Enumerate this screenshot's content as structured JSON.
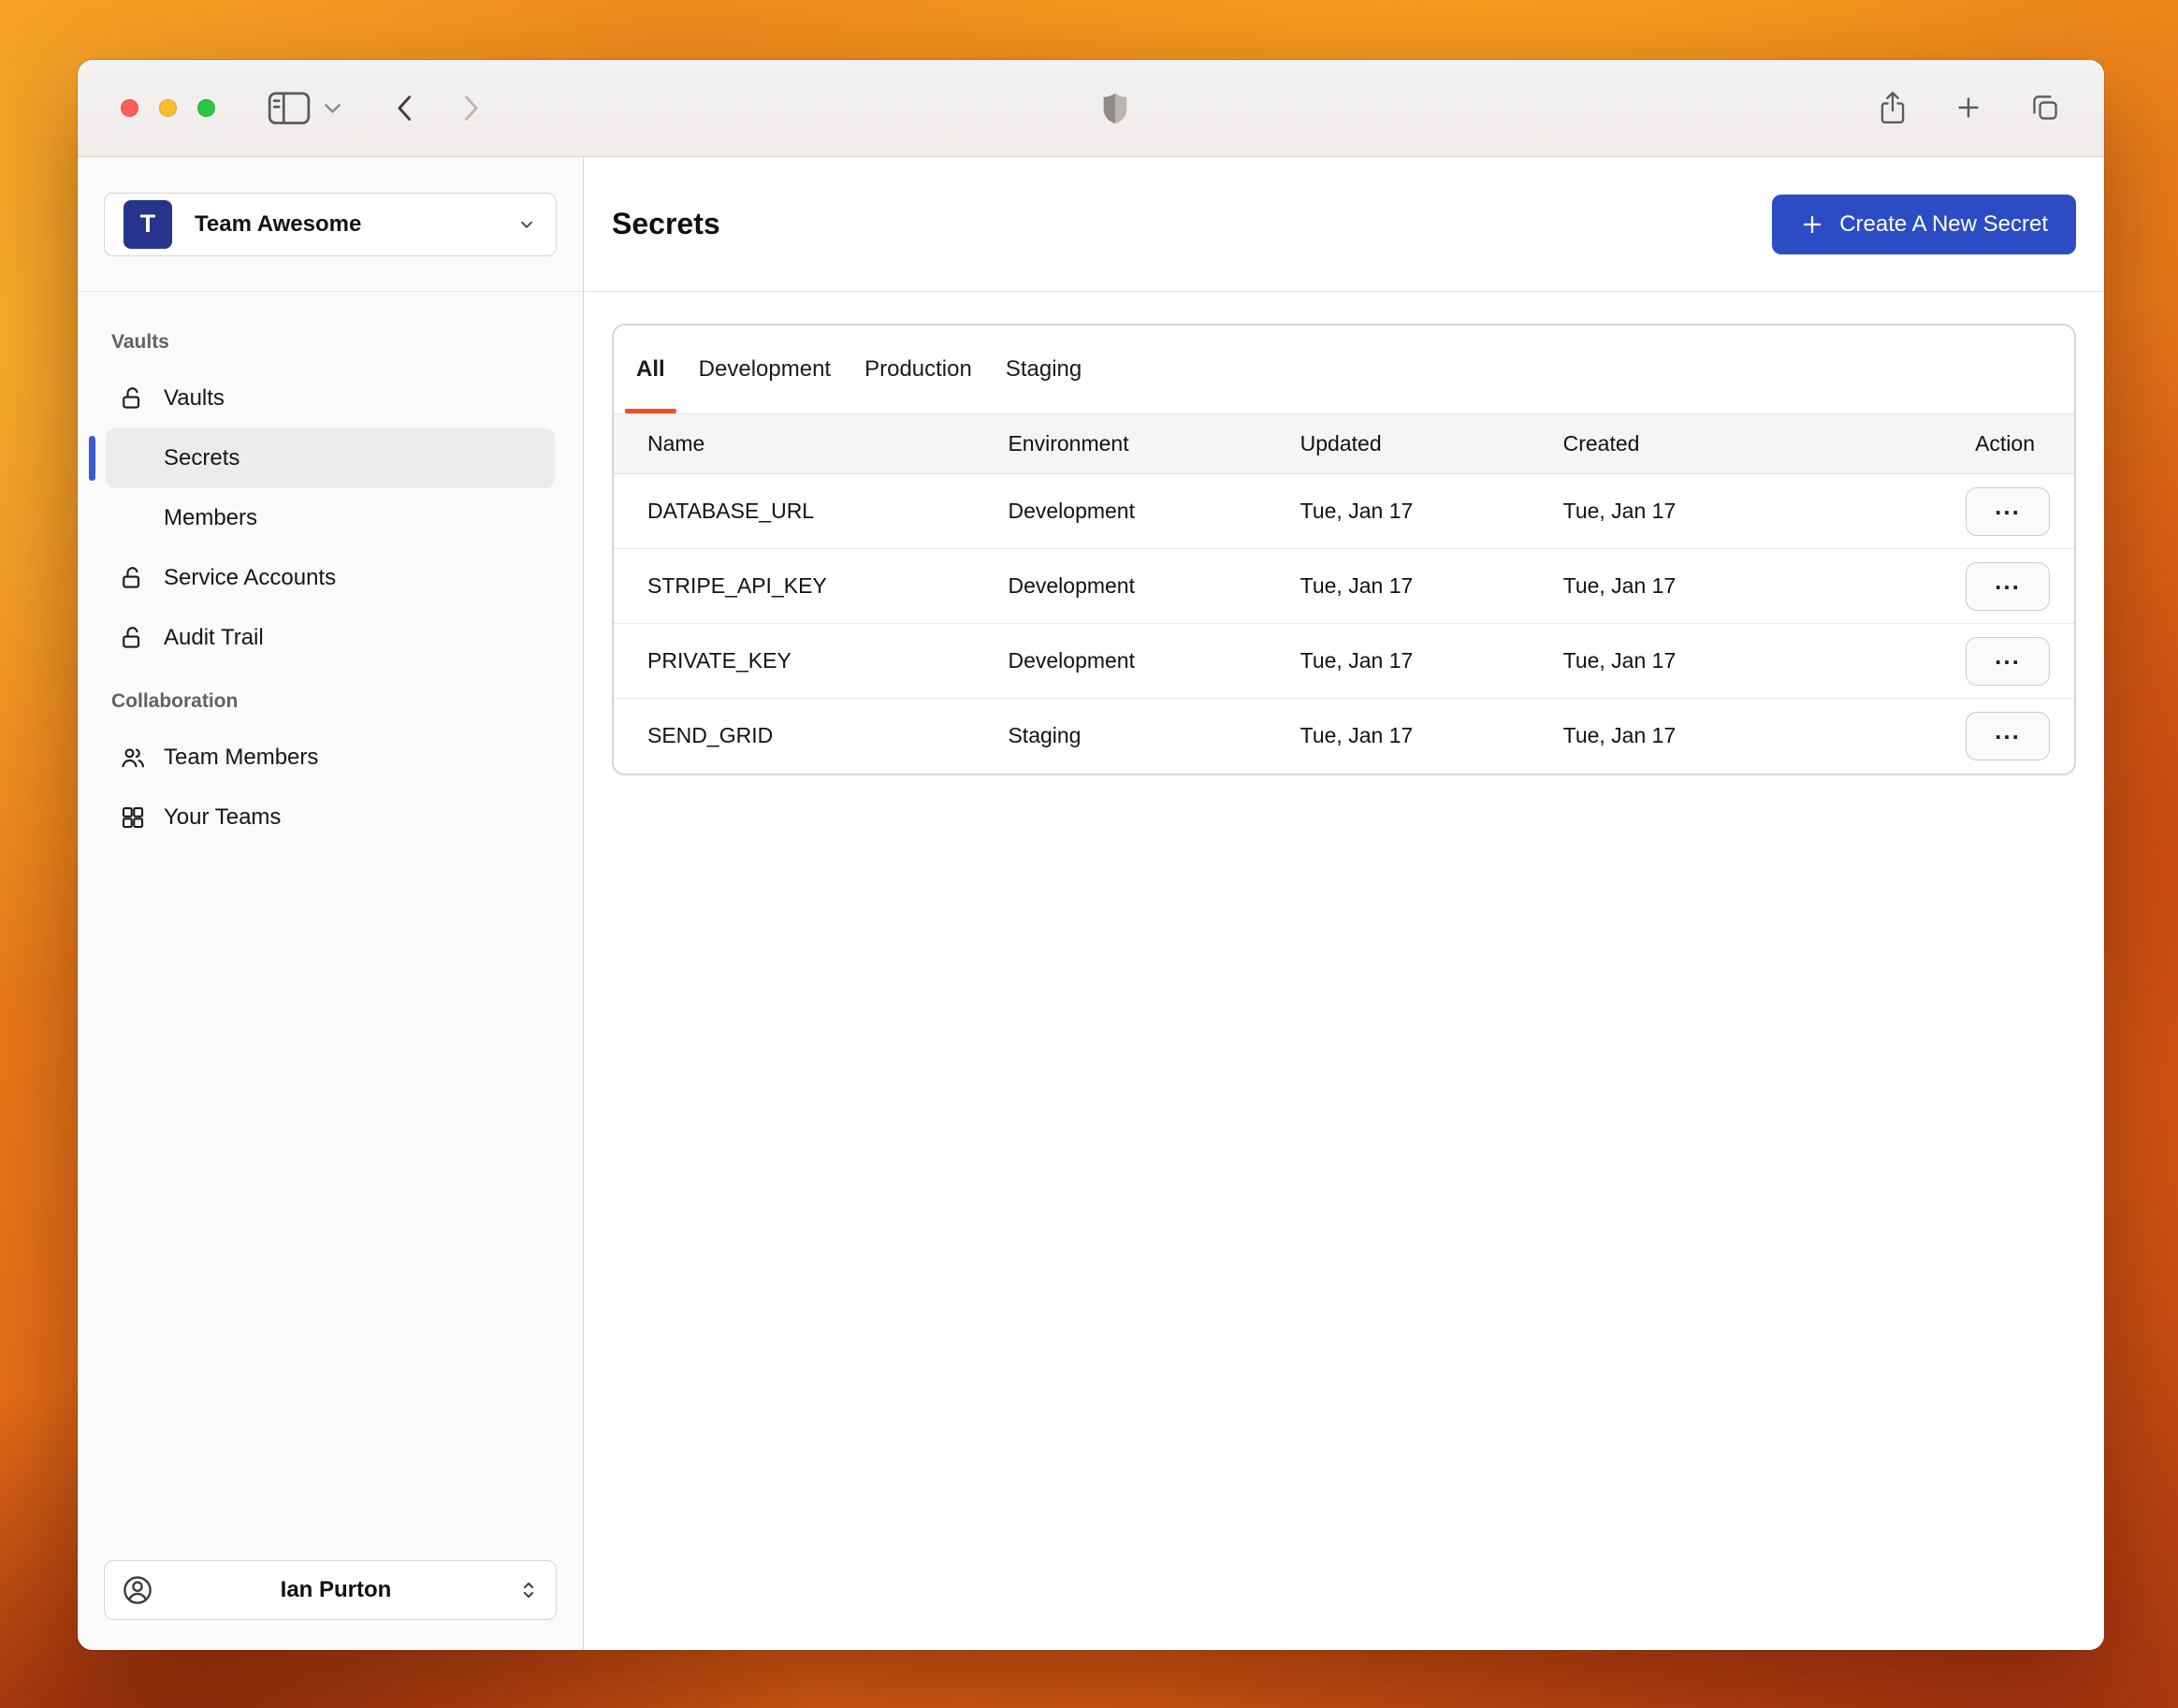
{
  "colors": {
    "accent": "#2b4cc4",
    "avatar": "#27348b",
    "underline": "#e8532c",
    "select-bar": "#3b5bd6"
  },
  "sidebar": {
    "team": {
      "initial": "T",
      "name": "Team Awesome"
    },
    "sections": [
      {
        "label": "Vaults",
        "items": [
          {
            "label": "Vaults"
          },
          {
            "label": "Secrets",
            "active": true
          },
          {
            "label": "Members"
          },
          {
            "label": "Service Accounts"
          },
          {
            "label": "Audit Trail"
          }
        ]
      },
      {
        "label": "Collaboration",
        "items": [
          {
            "label": "Team Members"
          },
          {
            "label": "Your Teams"
          }
        ]
      }
    ],
    "user": {
      "name": "Ian Purton"
    }
  },
  "main": {
    "title": "Secrets",
    "create_button_label": "Create A New Secret",
    "tabs": [
      {
        "label": "All",
        "active": true
      },
      {
        "label": "Development"
      },
      {
        "label": "Production"
      },
      {
        "label": "Staging"
      }
    ],
    "table": {
      "columns": [
        "Name",
        "Environment",
        "Updated",
        "Created",
        "Action"
      ],
      "action_label": "...",
      "rows": [
        {
          "name": "DATABASE_URL",
          "environment": "Development",
          "updated": "Tue, Jan 17",
          "created": "Tue, Jan 17"
        },
        {
          "name": "STRIPE_API_KEY",
          "environment": "Development",
          "updated": "Tue, Jan 17",
          "created": "Tue, Jan 17"
        },
        {
          "name": "PRIVATE_KEY",
          "environment": "Development",
          "updated": "Tue, Jan 17",
          "created": "Tue, Jan 17"
        },
        {
          "name": "SEND_GRID",
          "environment": "Staging",
          "updated": "Tue, Jan 17",
          "created": "Tue, Jan 17"
        }
      ]
    }
  }
}
